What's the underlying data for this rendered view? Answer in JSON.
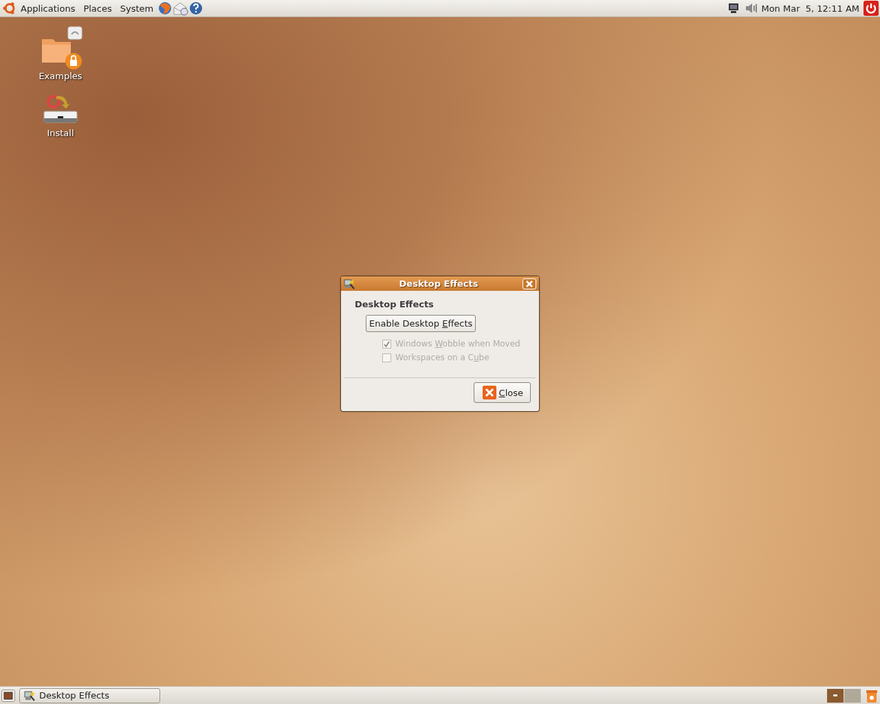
{
  "top_panel": {
    "menus": [
      {
        "label": "Applications"
      },
      {
        "label": "Places"
      },
      {
        "label": "System"
      }
    ],
    "clock": "Mon Mar  5, 12:11 AM"
  },
  "desktop_icons": [
    {
      "kind": "folder",
      "label": "Examples"
    },
    {
      "kind": "installer",
      "label": "Install"
    }
  ],
  "dialog": {
    "title": "Desktop Effects",
    "heading": "Desktop Effects",
    "enable_button": {
      "before": "Enable Desktop ",
      "accel": "E",
      "after": "ffects"
    },
    "options": [
      {
        "label": {
          "before": "Windows ",
          "accel": "W",
          "after": "obble when Moved"
        },
        "checked": true,
        "disabled": true
      },
      {
        "label": {
          "before": "Workspaces on a C",
          "accel": "u",
          "after": "be"
        },
        "checked": false,
        "disabled": true
      }
    ],
    "close_button": {
      "accel": "C",
      "after": "lose"
    }
  },
  "bottom_panel": {
    "tasks": [
      {
        "label": "Desktop Effects",
        "selected": false
      }
    ],
    "workspaces": [
      {
        "selected": true
      },
      {
        "selected": false
      }
    ]
  }
}
